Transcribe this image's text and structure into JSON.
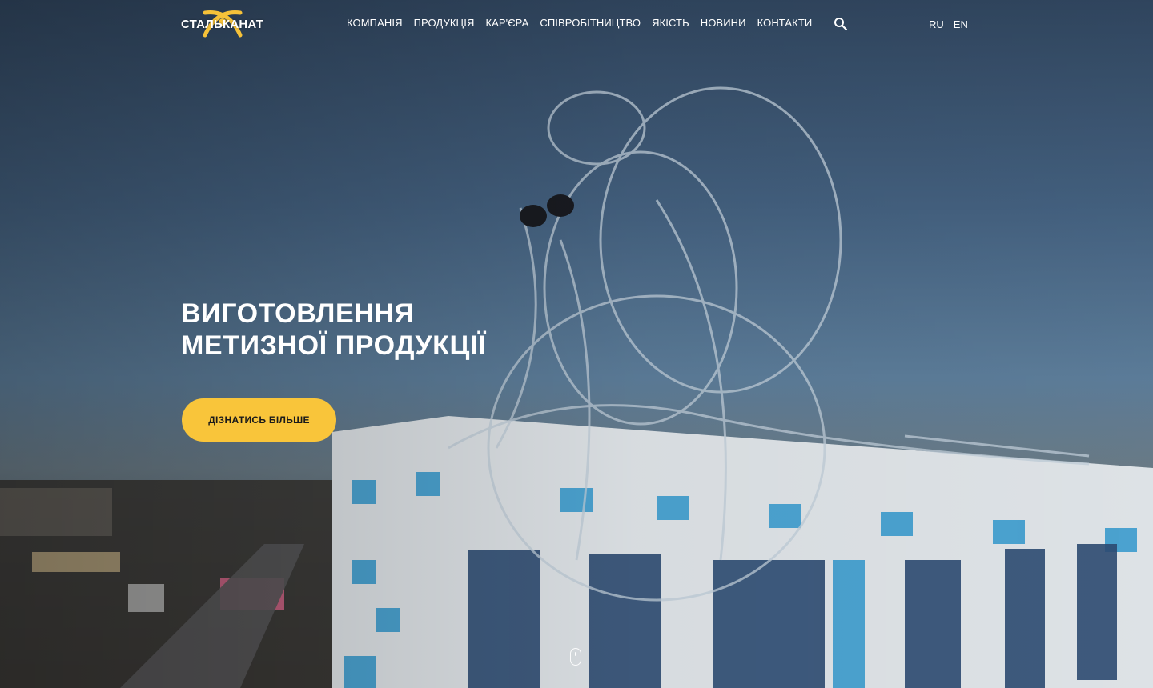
{
  "header": {
    "logo_text": "СТАЛЬКАНАТ",
    "nav": [
      {
        "label": "КОМПАНІЯ"
      },
      {
        "label": "ПРОДУКЦІЯ"
      },
      {
        "label": "КАР'ЄРА"
      },
      {
        "label": "СПІВРОБІТНИЦТВО"
      },
      {
        "label": "ЯКІСТЬ"
      },
      {
        "label": "НОВИНИ"
      },
      {
        "label": "КОНТАКТИ"
      }
    ],
    "search_icon": "search-icon",
    "languages": [
      "RU",
      "EN"
    ]
  },
  "hero": {
    "title_line1": "ВИГОТОВЛЕННЯ",
    "title_line2": "МЕТИЗНОЇ ПРОДУКЦІЇ",
    "cta_label": "ДІЗНАТИСЬ БІЛЬШЕ",
    "scroll_icon": "mouse-scroll-icon"
  },
  "colors": {
    "accent": "#f9c53a",
    "text": "#ffffff"
  }
}
